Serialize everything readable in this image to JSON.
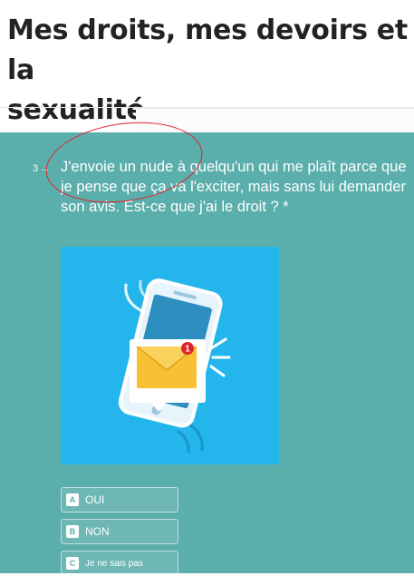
{
  "header": {
    "title": "Mes droits, mes devoirs et la\nsexualité"
  },
  "question": {
    "number": "3",
    "arrow": "→",
    "text": "J'envoie un nude à quelqu'un qui me plaît parce que je pense que ça va l'exciter, mais sans lui demander son avis. Est-ce que j'ai le droit ? *"
  },
  "illustration": {
    "description_icon": "phone-message-notification-icon",
    "badge": "1"
  },
  "choices": [
    {
      "key": "A",
      "label": "OUI"
    },
    {
      "key": "B",
      "label": "NON"
    },
    {
      "key": "C",
      "label": "Je ne sais pas"
    }
  ],
  "colors": {
    "background": "#5aaeab",
    "image_bg": "#24b5ec",
    "annotation": "#e0242e"
  }
}
